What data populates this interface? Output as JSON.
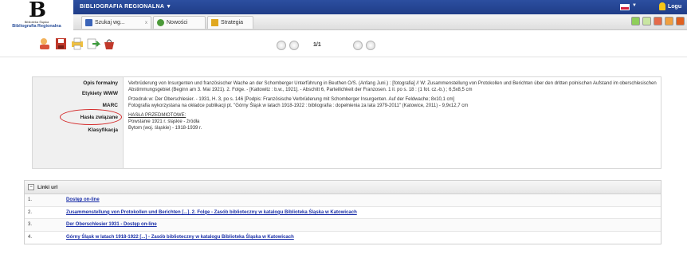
{
  "logo": {
    "mark": "B",
    "small_text": "Biblioteka Śląska",
    "app_name": "Bibliografia Regionalna"
  },
  "topbar": {
    "title": "BIBLIOGRAFIA REGIONALNA ▼",
    "flag_caret": "▼",
    "user_label": "Logu"
  },
  "tabs": [
    {
      "label": "Szukaj wg...",
      "icon": "search-tab-icon"
    },
    {
      "label": "Nowości",
      "icon": "news-tab-icon"
    },
    {
      "label": "Strategia",
      "icon": "strategy-tab-icon"
    }
  ],
  "tab_close": "x",
  "pager": {
    "page": "1/1"
  },
  "record": {
    "side_items": [
      "Opis formalny",
      "Etykiety WWW",
      "MARC",
      "Hasła związane",
      "Klasyfikacja"
    ],
    "paragraphs": [
      "Verbrüderung von Insurgenten und französischer Wache an der Schomberger Unterführung in Beuthen O/S. (Anfang Juni.) : [fotografia] // W: Zusammenstellung von Protokollen und Berichten über den dritten polnischen Aufstand im oberschlesischen Abstimmungsgebiet (Beginn am 3. Mai 1921). 2. Folge. - [Kattowitz : b.w., 1921]. - Abschitt 6, Parteilichkeit der Franzosen. 1 il. po s. 18 : (1 fot. cz.-b.) ; 6,5x8,5 cm",
      "Przedruk w: Der Oberschlesier. - 1931, H. 3, po s. 146 [Podpis: Französische Verbrüderung mit Schomberger Insurgenten. Auf der Feldwache; 8x10,1 cm]",
      "Fotografia wykorzystana na okładce publikacji pt. \"Górny Śląsk w latach 1918-1922 : bibliografia : dopełnienia za lata 1979-2011\" (Katowice, 2011) - 9,9x12,7 cm"
    ],
    "subject_heading_title": "HASŁA PRZEDMIOTOWE:",
    "subject_headings": [
      "Powstanie 1921 r. śląskie - źródła",
      "Bytom (woj. śląskie) - 1918-1939 r."
    ]
  },
  "links": {
    "title": "Linki url",
    "collapse_symbol": "−",
    "rows": [
      {
        "num": "1.",
        "text": "Dostęp on-line"
      },
      {
        "num": "2.",
        "text": "Zusammenstellung von Protokollen und Berichten [...]. 2. Folge - Zasób biblioteczny w katalogu Biblioteka Śląska w Katowicach"
      },
      {
        "num": "3.",
        "text": "Der Oberschlesier 1931 - Dostęp on-line"
      },
      {
        "num": "4.",
        "text": "Górny Śląsk w latach 1918-1922 [...] - Zasób biblioteczny w katalogu Biblioteka Śląska w Katowicach"
      }
    ]
  },
  "colors": {
    "topbar": "#2c4fa0",
    "link": "#1a2fa8",
    "highlight_circle": "#d42a2a"
  }
}
